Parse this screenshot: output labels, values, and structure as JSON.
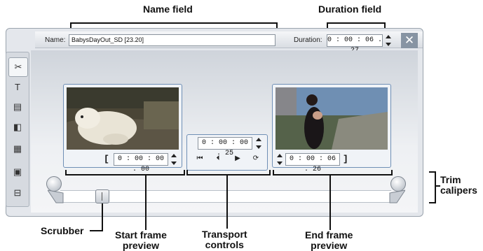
{
  "callouts": {
    "name_field": "Name field",
    "duration_field": "Duration field",
    "trim_calipers": "Trim\ncalipers",
    "scrubber": "Scrubber",
    "start_frame_preview": "Start frame\npreview",
    "transport_controls": "Transport\ncontrols",
    "end_frame_preview": "End frame\npreview"
  },
  "toolbar": {
    "name_label": "Name:",
    "name_value": "BabysDayOut_SD [23.20]",
    "duration_label": "Duration:",
    "duration_value": "0 : 00 : 06 . 27",
    "close_icon": "close-icon"
  },
  "sidebar": {
    "items": [
      {
        "icon": "scissors-icon",
        "glyph": "✂",
        "active": true
      },
      {
        "icon": "text-icon",
        "glyph": "T",
        "active": false
      },
      {
        "icon": "subtitle-icon",
        "glyph": "▤",
        "active": false
      },
      {
        "icon": "audio-icon",
        "glyph": "◧",
        "active": false
      },
      {
        "icon": "clapper-icon",
        "glyph": "▦",
        "active": false
      },
      {
        "icon": "frame-icon",
        "glyph": "▣",
        "active": false
      },
      {
        "icon": "plug-icon",
        "glyph": "⊟",
        "active": false
      }
    ]
  },
  "start_preview": {
    "timecode": "0 : 00 : 00 . 00",
    "bracket": "["
  },
  "transport": {
    "timecode": "0 : 00 : 00 . 25",
    "buttons": [
      {
        "icon": "rewind-to-start-icon",
        "glyph": "⏮"
      },
      {
        "icon": "step-back-icon",
        "glyph": "⏴"
      },
      {
        "icon": "play-icon",
        "glyph": "▶"
      },
      {
        "icon": "loop-icon",
        "glyph": "⟳"
      }
    ]
  },
  "end_preview": {
    "timecode": "0 : 00 : 06 . 26",
    "bracket": "]"
  }
}
